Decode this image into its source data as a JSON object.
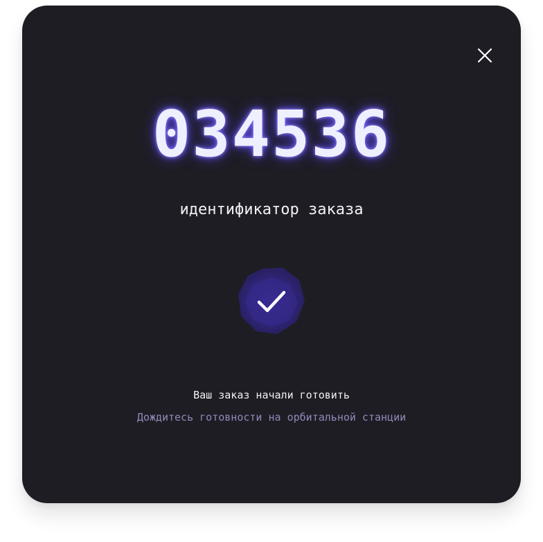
{
  "modal": {
    "order_number": "034536",
    "order_caption": "идентификатор заказа",
    "status_title": "Ваш заказ начали готовить",
    "status_subtitle": "Дождитесь готовности на орбитальной станции"
  },
  "icons": {
    "close": "close-icon",
    "check": "checkmark-icon"
  },
  "colors": {
    "background": "#1e1d24",
    "number_glow": "#6e5aff",
    "badge": "#3a2f8f",
    "subtitle": "#8f8ab8"
  }
}
